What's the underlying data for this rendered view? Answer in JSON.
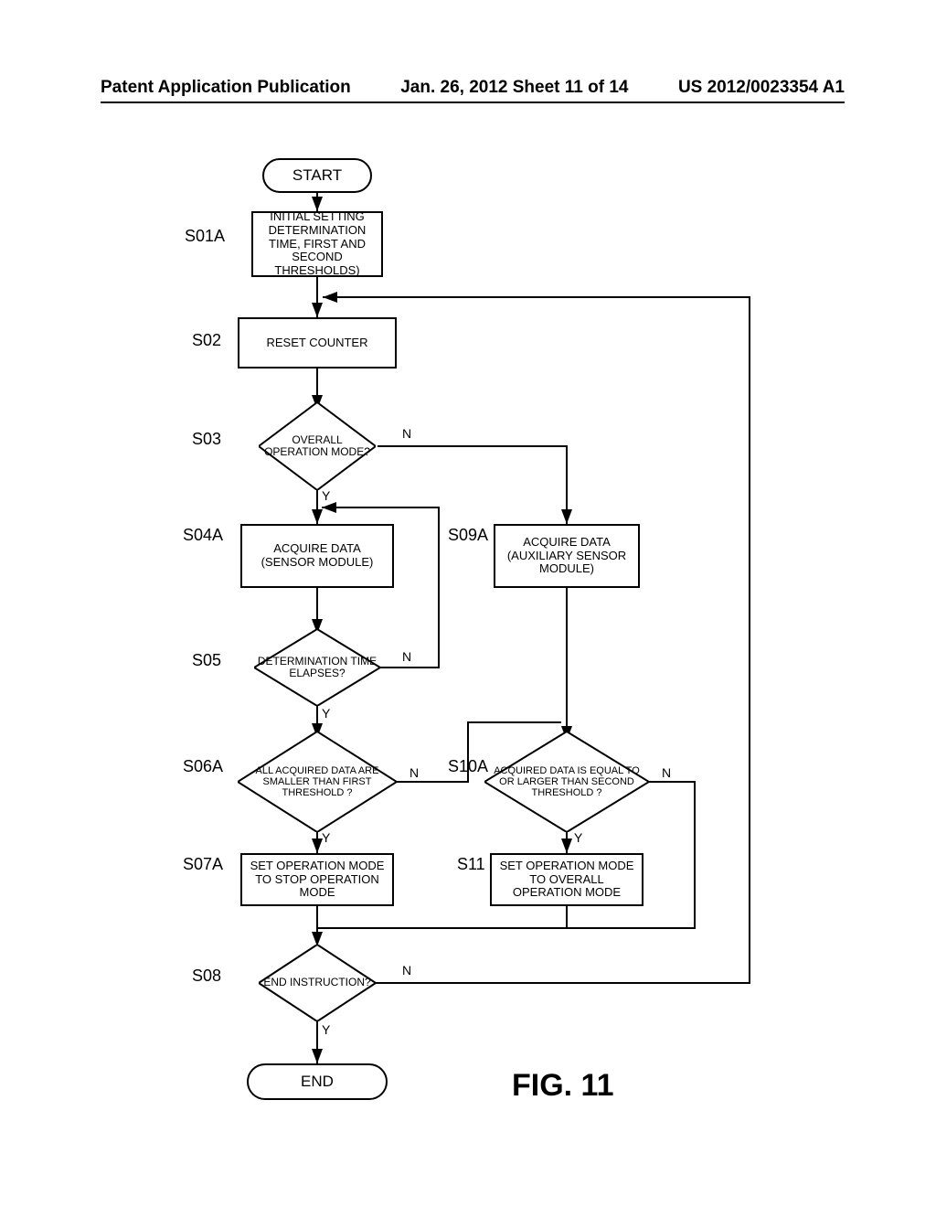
{
  "header": {
    "left": "Patent Application Publication",
    "mid": "Jan. 26, 2012  Sheet 11 of 14",
    "right": "US 2012/0023354 A1"
  },
  "figure_label": "FIG. 11",
  "nodes": {
    "start": "START",
    "end": "END",
    "s01a": {
      "id": "S01A",
      "text": "INITIAL SETTING DETERMINATION TIME, FIRST AND SECOND THRESHOLDS)"
    },
    "s02": {
      "id": "S02",
      "text": "RESET COUNTER"
    },
    "s03": {
      "id": "S03",
      "text": "OVERALL OPERATION MODE?"
    },
    "s04a": {
      "id": "S04A",
      "text": "ACQUIRE DATA (SENSOR MODULE)"
    },
    "s05": {
      "id": "S05",
      "text": "DETERMINATION TIME ELAPSES?"
    },
    "s06a": {
      "id": "S06A",
      "text": "ALL ACQUIRED DATA ARE SMALLER THAN FIRST THRESHOLD ?"
    },
    "s07a": {
      "id": "S07A",
      "text": "SET OPERATION MODE TO STOP OPERATION MODE"
    },
    "s08": {
      "id": "S08",
      "text": "END INSTRUCTION?"
    },
    "s09a": {
      "id": "S09A",
      "text": "ACQUIRE DATA (AUXILIARY SENSOR MODULE)"
    },
    "s10a": {
      "id": "S10A",
      "text": "ACQUIRED DATA IS EQUAL TO OR LARGER THAN SECOND THRESHOLD ?"
    },
    "s11": {
      "id": "S11",
      "text": "SET OPERATION MODE TO OVERALL OPERATION MODE"
    }
  },
  "edge": {
    "Y": "Y",
    "N": "N"
  },
  "chart_data": {
    "type": "flowchart",
    "title": "FIG. 11",
    "nodes": [
      {
        "id": "START",
        "type": "terminator",
        "label": "START"
      },
      {
        "id": "S01A",
        "type": "process",
        "label": "INITIAL SETTING DETERMINATION TIME, FIRST AND SECOND THRESHOLDS)"
      },
      {
        "id": "S02",
        "type": "process",
        "label": "RESET COUNTER"
      },
      {
        "id": "S03",
        "type": "decision",
        "label": "OVERALL OPERATION MODE?"
      },
      {
        "id": "S04A",
        "type": "process",
        "label": "ACQUIRE DATA (SENSOR MODULE)"
      },
      {
        "id": "S05",
        "type": "decision",
        "label": "DETERMINATION TIME ELAPSES?"
      },
      {
        "id": "S06A",
        "type": "decision",
        "label": "ALL ACQUIRED DATA ARE SMALLER THAN FIRST THRESHOLD ?"
      },
      {
        "id": "S07A",
        "type": "process",
        "label": "SET OPERATION MODE TO STOP OPERATION MODE"
      },
      {
        "id": "S08",
        "type": "decision",
        "label": "END INSTRUCTION?"
      },
      {
        "id": "S09A",
        "type": "process",
        "label": "ACQUIRE DATA (AUXILIARY SENSOR MODULE)"
      },
      {
        "id": "S10A",
        "type": "decision",
        "label": "ACQUIRED DATA IS EQUAL TO OR LARGER THAN SECOND THRESHOLD ?"
      },
      {
        "id": "S11",
        "type": "process",
        "label": "SET OPERATION MODE TO OVERALL OPERATION MODE"
      },
      {
        "id": "END",
        "type": "terminator",
        "label": "END"
      }
    ],
    "edges": [
      {
        "from": "START",
        "to": "S01A"
      },
      {
        "from": "S01A",
        "to": "S02"
      },
      {
        "from": "S02",
        "to": "S03"
      },
      {
        "from": "S03",
        "to": "S04A",
        "label": "Y"
      },
      {
        "from": "S03",
        "to": "S09A",
        "label": "N"
      },
      {
        "from": "S04A",
        "to": "S05"
      },
      {
        "from": "S05",
        "to": "S06A",
        "label": "Y"
      },
      {
        "from": "S05",
        "to": "S04A",
        "label": "N"
      },
      {
        "from": "S06A",
        "to": "S07A",
        "label": "Y"
      },
      {
        "from": "S06A",
        "to": "S10A",
        "label": "N"
      },
      {
        "from": "S07A",
        "to": "S08"
      },
      {
        "from": "S08",
        "to": "END",
        "label": "Y"
      },
      {
        "from": "S08",
        "to": "S02",
        "label": "N"
      },
      {
        "from": "S09A",
        "to": "S10A"
      },
      {
        "from": "S10A",
        "to": "S11",
        "label": "Y"
      },
      {
        "from": "S10A",
        "to": "S08",
        "label": "N"
      },
      {
        "from": "S11",
        "to": "S08"
      }
    ]
  }
}
